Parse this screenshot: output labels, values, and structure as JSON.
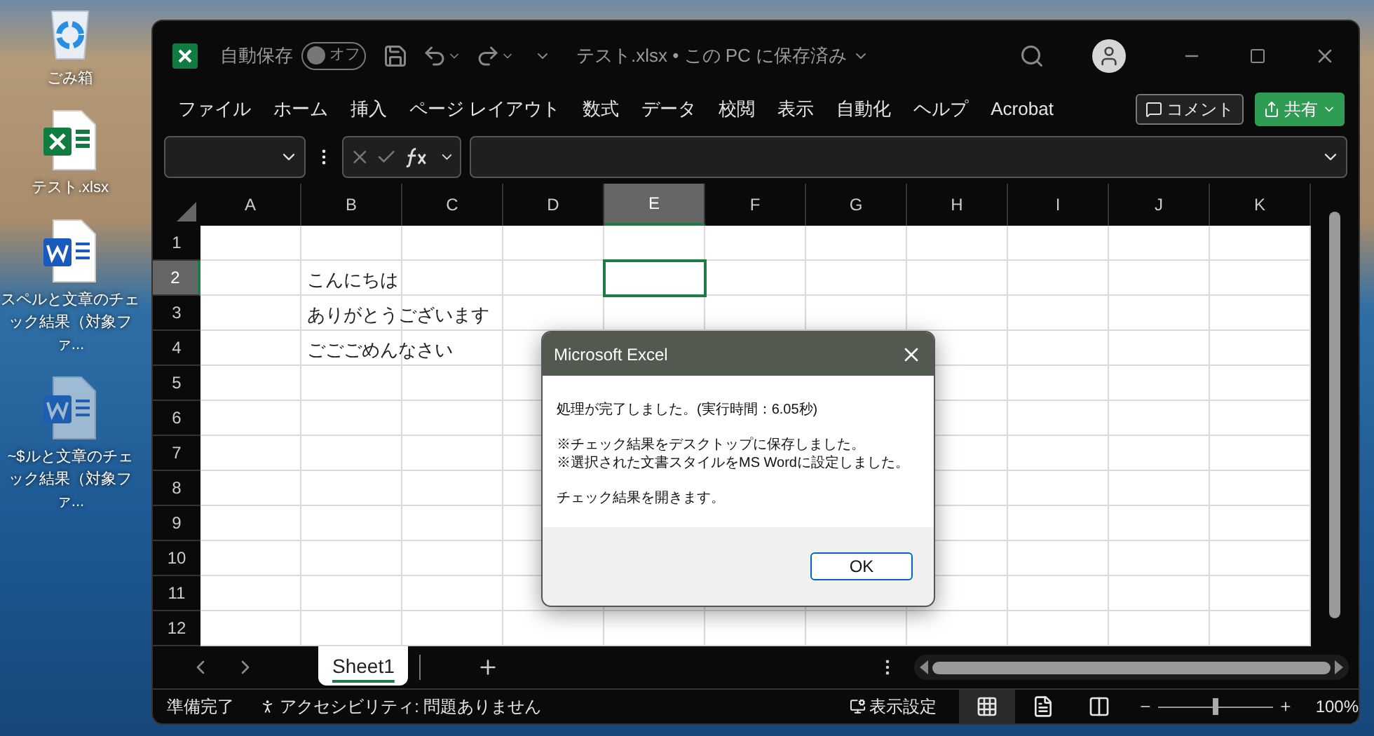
{
  "desktop_icons": [
    {
      "kind": "recycle",
      "label": "ごみ箱"
    },
    {
      "kind": "excel",
      "label": "テスト.xlsx"
    },
    {
      "kind": "word",
      "label": "スペルと文章のチェック結果（対象ファ..."
    },
    {
      "kind": "word_temp",
      "label": "~$ルと文章のチェック結果（対象ファ..."
    }
  ],
  "title_bar": {
    "autosave_label": "自動保存",
    "autosave_toggle": {
      "label": "オフ",
      "on": false
    },
    "file_title": "テスト.xlsx • この PC に保存済み"
  },
  "menu": {
    "items": [
      "ファイル",
      "ホーム",
      "挿入",
      "ページ レイアウト",
      "数式",
      "データ",
      "校閲",
      "表示",
      "自動化",
      "ヘルプ",
      "Acrobat"
    ],
    "comment_button": "コメント",
    "share_button": "共有"
  },
  "columns": [
    {
      "label": "A",
      "selected": false
    },
    {
      "label": "B",
      "selected": false
    },
    {
      "label": "C",
      "selected": false
    },
    {
      "label": "D",
      "selected": false
    },
    {
      "label": "E",
      "selected": true
    },
    {
      "label": "F",
      "selected": false
    },
    {
      "label": "G",
      "selected": false
    },
    {
      "label": "H",
      "selected": false
    },
    {
      "label": "I",
      "selected": false
    },
    {
      "label": "J",
      "selected": false
    },
    {
      "label": "K",
      "selected": false
    }
  ],
  "rows": [
    {
      "label": "1",
      "selected": false
    },
    {
      "label": "2",
      "selected": true,
      "cell_b": "こんにちは"
    },
    {
      "label": "3",
      "selected": false,
      "cell_b": "ありがとうございます"
    },
    {
      "label": "4",
      "selected": false,
      "cell_b": "ごごごめんなさい"
    },
    {
      "label": "5",
      "selected": false
    },
    {
      "label": "6",
      "selected": false
    },
    {
      "label": "7",
      "selected": false
    },
    {
      "label": "8",
      "selected": false
    },
    {
      "label": "9",
      "selected": false
    },
    {
      "label": "10",
      "selected": false
    },
    {
      "label": "11",
      "selected": false
    },
    {
      "label": "12",
      "selected": false
    }
  ],
  "sheet_tabs": [
    {
      "label": "Sheet1",
      "selected": true
    }
  ],
  "status_bar": {
    "ready": "準備完了",
    "accessibility": "アクセシビリティ: 問題ありません",
    "display_settings": "表示設定",
    "views": [
      {
        "kind": "normal",
        "selected": true
      },
      {
        "kind": "page_layout",
        "selected": false
      },
      {
        "kind": "page_break",
        "selected": false
      }
    ],
    "zoom": {
      "level": 0.5,
      "reading": "100%"
    }
  },
  "dialog": {
    "title": "Microsoft Excel",
    "paragraphs": [
      [
        "処理が完了しました。(実行時間：6.05秒)"
      ],
      [
        "※チェック結果をデスクトップに保存しました。",
        "※選択された文書スタイルをMS Wordに設定しました。"
      ],
      [
        "チェック結果を開きます。"
      ]
    ],
    "ok_button": "OK"
  }
}
